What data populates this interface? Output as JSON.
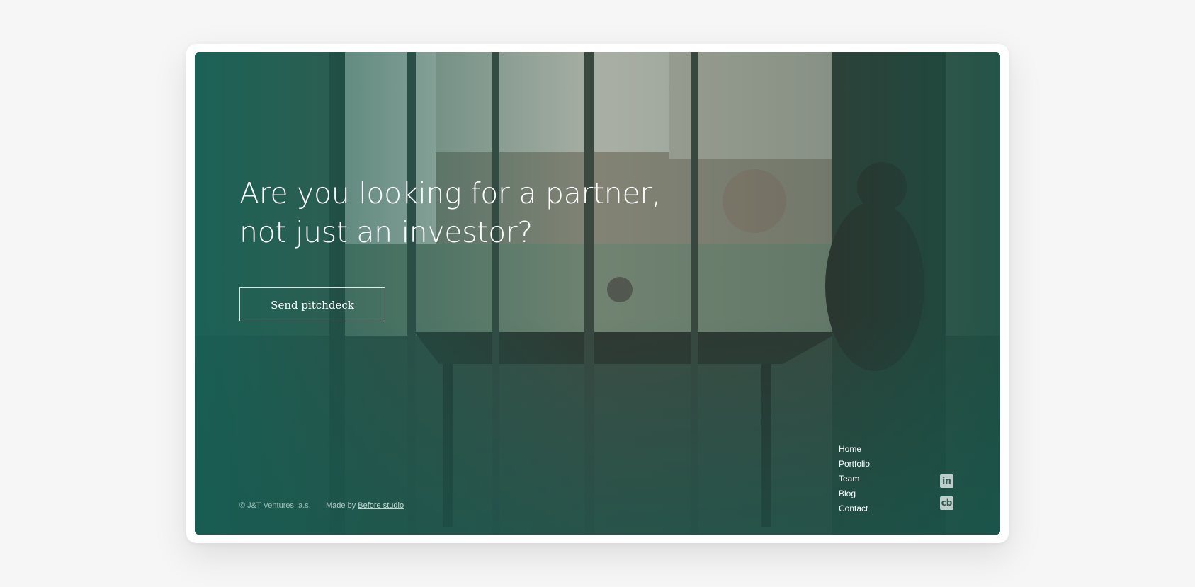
{
  "hero": {
    "headline_line1": "Are you looking for a partner,",
    "headline_line2": "not just an investor?",
    "cta_label": "Send pitchdeck"
  },
  "footer": {
    "copyright": "© J&T Ventures, a.s.",
    "made_by_prefix": "Made by",
    "made_by_link": "Before studio"
  },
  "nav": {
    "items": [
      {
        "label": "Home"
      },
      {
        "label": "Portfolio"
      },
      {
        "label": "Team"
      },
      {
        "label": "Blog"
      },
      {
        "label": "Contact"
      }
    ]
  },
  "social": {
    "linkedin": {
      "icon": "linkedin-icon",
      "glyph": "in"
    },
    "crunchbase": {
      "icon": "crunchbase-icon",
      "glyph": "cb"
    }
  },
  "colors": {
    "page_background": "#f6f6f6",
    "overlay_teal": "#156156",
    "text": "#ffffff"
  }
}
